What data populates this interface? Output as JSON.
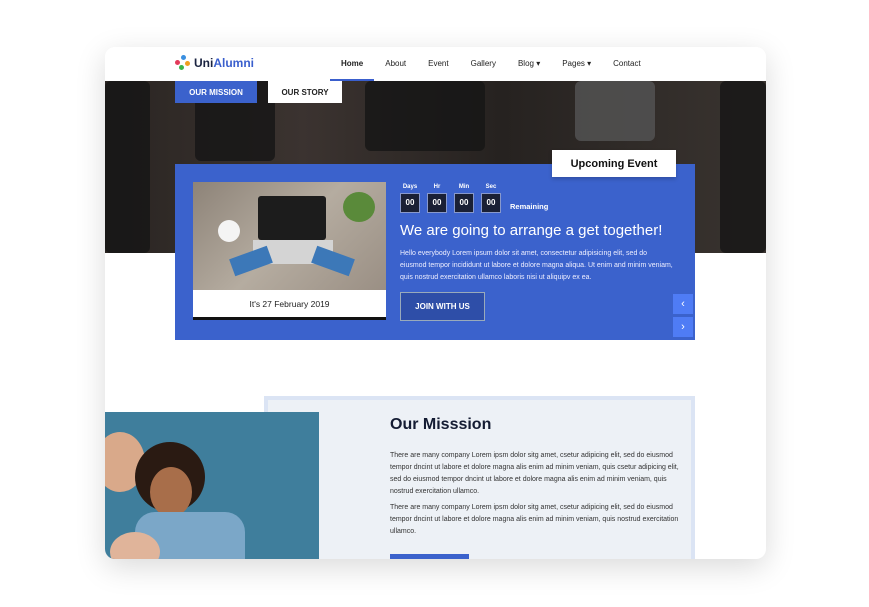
{
  "nav": {
    "logo_text_a": "Uni",
    "logo_text_b": "Alumni",
    "items": [
      {
        "label": "Home",
        "active": true
      },
      {
        "label": "About"
      },
      {
        "label": "Event"
      },
      {
        "label": "Gallery"
      },
      {
        "label": "Blog ▾"
      },
      {
        "label": "Pages ▾"
      },
      {
        "label": "Contact"
      }
    ]
  },
  "hero": {
    "mission_btn": "OUR MISSION",
    "story_btn": "OUR STORY"
  },
  "event": {
    "badge": "Upcoming Event",
    "date": "It's 27 February 2019",
    "countdown": [
      {
        "label": "Days",
        "value": "00"
      },
      {
        "label": "Hr",
        "value": "00"
      },
      {
        "label": "Min",
        "value": "00"
      },
      {
        "label": "Sec",
        "value": "00"
      }
    ],
    "remaining": "Remaining",
    "title": "We are going to arrange a get together!",
    "desc": "Hello everybody Lorem ipsum dolor sit amet, consectetur adipisicing elit, sed do eiusmod tempor incididunt ut labore et dolore magna aliqua. Ut enim and minim veniam, quis nostrud exercitation ullamco laboris nisi ut aliquipv ex ea.",
    "join": "JOIN WITH US",
    "prev": "‹",
    "next": "›"
  },
  "mission": {
    "title": "Our Misssion",
    "p1": "There are many company Lorem ipsm dolor sitg amet, csetur adipicing elit, sed do eiusmod tempor dncint ut labore et dolore magna alis enim ad minim veniam, quis csetur adipicing elit, sed do eiusmod tempor dncint ut labore et dolore magna alis enim ad minim veniam, quis nostrud exercitation ullamco.",
    "p2": "There are many company Lorem ipsm dolor sitg amet, csetur adipicing elit, sed do eiusmod tempor dncint ut labore et dolore magna alis enim ad minim veniam, quis nostrud exercitation ullamco."
  },
  "colors": {
    "primary": "#3b62cc",
    "dark": "#141c33"
  }
}
